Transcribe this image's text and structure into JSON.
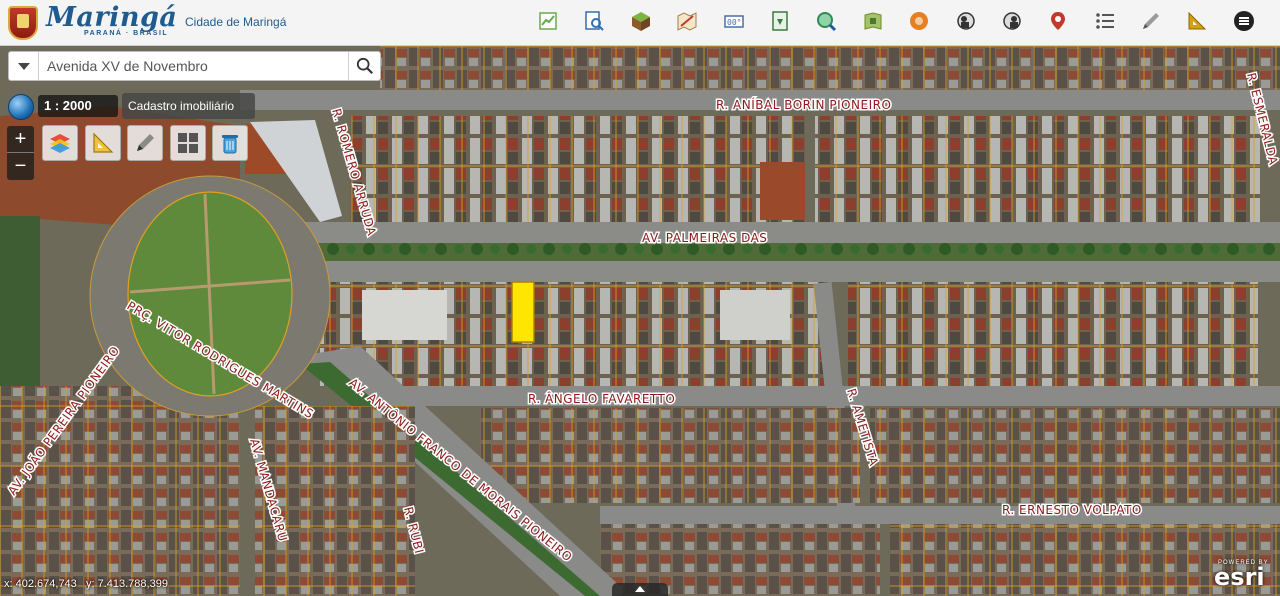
{
  "header": {
    "brand_name": "Maringá",
    "brand_sub": "PARANÁ · BRASIL",
    "city_link": "Cidade de Maringá",
    "tools": [
      {
        "icon": "chart-report-icon",
        "color": "#6aa84f"
      },
      {
        "icon": "search-document-icon",
        "color": "#2f6fb3"
      },
      {
        "icon": "cube-3d-icon",
        "color": "#6b8e23"
      },
      {
        "icon": "map-draw-icon",
        "color": "#c0392b"
      },
      {
        "icon": "coordinates-icon",
        "color": "#4a6fa5"
      },
      {
        "icon": "download-doc-icon",
        "color": "#3d7a3d"
      },
      {
        "icon": "zoom-globe-icon",
        "color": "#2e8b57"
      },
      {
        "icon": "map-layers-icon",
        "color": "#6b8e23"
      },
      {
        "icon": "orange-circle-icon",
        "color": "#e67e22"
      },
      {
        "icon": "street-view-icon",
        "color": "#333333"
      },
      {
        "icon": "street-view-alt-icon",
        "color": "#333333"
      },
      {
        "icon": "location-pin-icon",
        "color": "#c0392b"
      },
      {
        "icon": "list-icon",
        "color": "#555555"
      },
      {
        "icon": "pencil-icon",
        "color": "#555555"
      },
      {
        "icon": "ruler-triangle-icon",
        "color": "#d4a017"
      },
      {
        "icon": "menu-icon",
        "color": "#222222"
      }
    ]
  },
  "search": {
    "value": "Avenida XV de Novembro"
  },
  "map": {
    "scale_prefix": "1 :",
    "scale_value": "2000",
    "layer_name": "Cadastro imobiliário",
    "highlight_color": "#ffe600",
    "lot_line_color": "#e0a020",
    "streets": [
      "R. ANÍBAL BORIN PIONEIRO",
      "R. ESMERALDA",
      "R. ROMERO ARRUDA",
      "AV. PALMEIRAS DAS",
      "PRÇ. VITOR RODRIGUES MARTINS",
      "AV. ANTÔNIO FRANCO DE MORAIS PIONEIRO",
      "R. ÂNGELO FAVARETTO",
      "R. AMETISTA",
      "AV. JOÃO PEREIRA PIONEIRO",
      "AV. MANDACARU",
      "R. RUBI",
      "R. ERNESTO VOLPATO"
    ]
  },
  "footer": {
    "x_label": "x:",
    "x_value": "402.674,743",
    "y_label": "y:",
    "y_value": "7.413.788,399",
    "esri_powered": "POWERED BY",
    "esri_name": "esri"
  }
}
